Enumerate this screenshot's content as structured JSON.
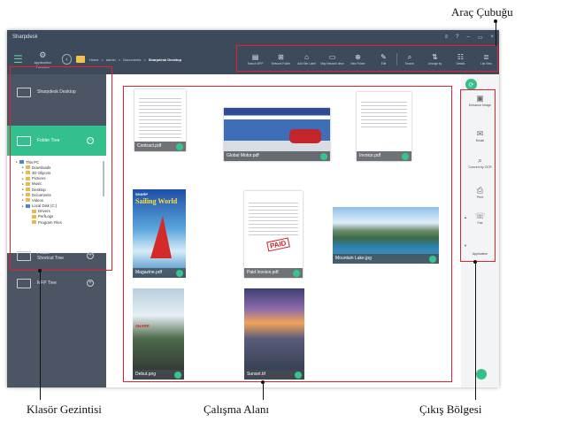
{
  "window": {
    "title": "Sharpdesk",
    "controls": [
      "≡",
      "?",
      "–",
      "▭",
      "×"
    ]
  },
  "toolbar": {
    "app_function_label": "Application Function",
    "back_icon": "chevron-left-icon",
    "breadcrumb": [
      "Home",
      ">",
      "admin",
      ">",
      "Documents",
      ">"
    ],
    "breadcrumb_current": "Sharpdesk Desktop",
    "tools": [
      {
        "label": "Search MFP",
        "icon": "printer-icon"
      },
      {
        "label": "Network Folder",
        "icon": "network-folder-icon"
      },
      {
        "label": "Add Site Label",
        "icon": "site-label-icon"
      },
      {
        "label": "Map Network drive",
        "icon": "map-drive-icon"
      },
      {
        "label": "New Folder",
        "icon": "new-folder-icon"
      },
      {
        "label": "Edit",
        "icon": "edit-icon"
      },
      {
        "label": "Search",
        "icon": "search-icon"
      },
      {
        "label": "Arrange by",
        "icon": "arrange-icon"
      },
      {
        "label": "Details",
        "icon": "details-icon"
      },
      {
        "label": "List View",
        "icon": "list-view-icon"
      }
    ]
  },
  "sidebar": {
    "desktop_label": "Sharpdesk Desktop",
    "folder_tree_label": "Folder Tree",
    "folder_shortcut_label": "Folder\nShortcut Tree",
    "mfp_tree_label": "MFP Tree",
    "tree": [
      {
        "label": "This PC",
        "level": 0,
        "kind": "pc"
      },
      {
        "label": "Downloads",
        "level": 1,
        "kind": "folder"
      },
      {
        "label": "3D Objects",
        "level": 1,
        "kind": "folder"
      },
      {
        "label": "Pictures",
        "level": 1,
        "kind": "folder"
      },
      {
        "label": "Music",
        "level": 1,
        "kind": "folder"
      },
      {
        "label": "Desktop",
        "level": 1,
        "kind": "folder"
      },
      {
        "label": "Documents",
        "level": 1,
        "kind": "folder"
      },
      {
        "label": "Videos",
        "level": 1,
        "kind": "folder"
      },
      {
        "label": "Local Disk (C:)",
        "level": 1,
        "kind": "pc"
      },
      {
        "label": "Drivers",
        "level": 2,
        "kind": "folder"
      },
      {
        "label": "PerfLogs",
        "level": 2,
        "kind": "folder"
      },
      {
        "label": "Program Files",
        "level": 2,
        "kind": "folder"
      }
    ]
  },
  "files": [
    {
      "name": "Contract.pdf",
      "kind": "document"
    },
    {
      "name": "Global Motor.pdf",
      "kind": "brochure"
    },
    {
      "name": "Invoice.pdf",
      "kind": "document"
    },
    {
      "name": "Magazine.pdf",
      "kind": "magazine",
      "cover_brand": "SHARP",
      "cover_title": "Sailing World"
    },
    {
      "name": "Paid Invoice.pdf",
      "kind": "document",
      "stamp": "PAID"
    },
    {
      "name": "Mountain Lake.jpg",
      "kind": "photo"
    },
    {
      "name": "Debut.png",
      "kind": "photo",
      "cover_brand": "SHARP"
    },
    {
      "name": "Sunset.tif",
      "kind": "photo"
    }
  ],
  "output": {
    "items": [
      {
        "label": "Enhance Image",
        "icon": "enhance-image-icon"
      },
      {
        "label": "Email",
        "icon": "email-icon"
      },
      {
        "label": "Convert by OCR",
        "icon": "ocr-icon"
      },
      {
        "label": "Print",
        "icon": "print-icon"
      },
      {
        "label": "Fax",
        "icon": "fax-icon"
      },
      {
        "label": "Application",
        "icon": "application-icon"
      }
    ]
  },
  "callouts": {
    "toolbar": "Araç Çubuğu",
    "folder_navigation": "Klasör Gezintisi",
    "work_area": "Çalışma Alanı",
    "output_area": "Çıkış Bölgesi"
  },
  "colors": {
    "accent_green": "#33c08c",
    "chrome_dark": "#3d4a5c",
    "sidebar": "#4b5564",
    "highlight_red": "#e8202e"
  }
}
